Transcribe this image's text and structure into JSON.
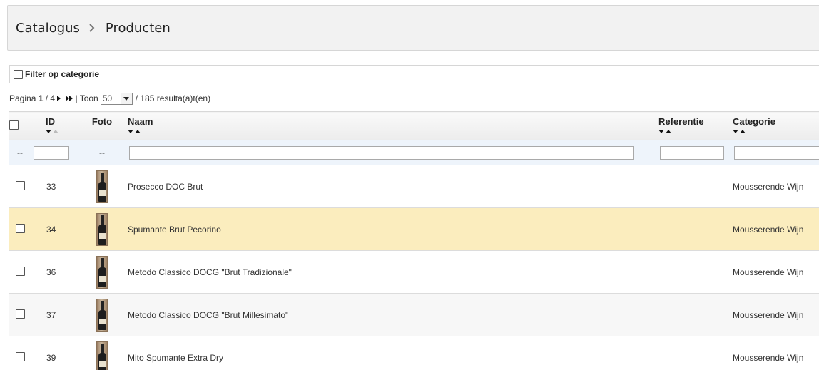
{
  "breadcrumb": {
    "root": "Catalogus",
    "current": "Producten"
  },
  "filter": {
    "label": "Filter op categorie"
  },
  "pager": {
    "prefix": "Pagina",
    "page": "1",
    "of": "/ 4",
    "show_label": "| Toon",
    "per_page": "50",
    "results": "/ 185 resulta(a)t(en)"
  },
  "columns": {
    "id": "ID",
    "photo": "Foto",
    "name": "Naam",
    "reference": "Referentie",
    "category": "Categorie"
  },
  "filter_row": {
    "select_placeholder": "--",
    "photo_placeholder": "--"
  },
  "rows": [
    {
      "id": "33",
      "name": "Prosecco DOC Brut",
      "reference": "",
      "category": "Mousserende Wijn"
    },
    {
      "id": "34",
      "name": "Spumante Brut Pecorino",
      "reference": "",
      "category": "Mousserende Wijn"
    },
    {
      "id": "36",
      "name": "Metodo Classico DOCG \"Brut Tradizionale\"",
      "reference": "",
      "category": "Mousserende Wijn"
    },
    {
      "id": "37",
      "name": "Metodo Classico DOCG \"Brut Millesimato\"",
      "reference": "",
      "category": "Mousserende Wijn"
    },
    {
      "id": "39",
      "name": "Mito Spumante Extra Dry",
      "reference": "",
      "category": "Mousserende Wijn"
    }
  ],
  "colors": {
    "highlight_row": "#fbedbe",
    "filter_row_bg": "#eef4fb"
  }
}
